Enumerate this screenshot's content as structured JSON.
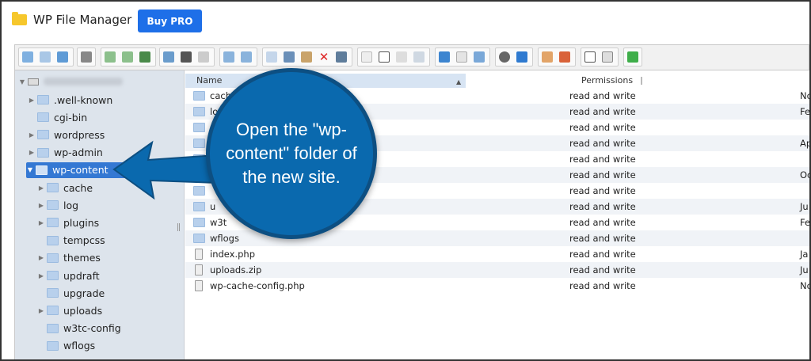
{
  "header": {
    "app_title": "WP File Manager",
    "buy_label": "Buy PRO"
  },
  "tree": {
    "items": [
      {
        "label": ".well-known",
        "indent": 1,
        "arrow": true
      },
      {
        "label": "cgi-bin",
        "indent": 1,
        "arrow": false
      },
      {
        "label": "wordpress",
        "indent": 1,
        "arrow": true
      },
      {
        "label": "wp-admin",
        "indent": 1,
        "arrow": true
      },
      {
        "label": "wp-content",
        "indent": 1,
        "arrow": true,
        "selected": true
      },
      {
        "label": "cache",
        "indent": 2,
        "arrow": true
      },
      {
        "label": "log",
        "indent": 2,
        "arrow": true
      },
      {
        "label": "plugins",
        "indent": 2,
        "arrow": true
      },
      {
        "label": "tempcss",
        "indent": 2,
        "arrow": false
      },
      {
        "label": "themes",
        "indent": 2,
        "arrow": true
      },
      {
        "label": "updraft",
        "indent": 2,
        "arrow": true
      },
      {
        "label": "upgrade",
        "indent": 2,
        "arrow": false
      },
      {
        "label": "uploads",
        "indent": 2,
        "arrow": true
      },
      {
        "label": "w3tc-config",
        "indent": 2,
        "arrow": false
      },
      {
        "label": "wflogs",
        "indent": 2,
        "arrow": false
      }
    ]
  },
  "list": {
    "col_name": "Name",
    "col_permissions": "Permissions",
    "rows": [
      {
        "name": "cache",
        "type": "folder",
        "perm": "read and write",
        "date": "No"
      },
      {
        "name": "lo",
        "type": "folder",
        "perm": "read and write",
        "date": "Fe"
      },
      {
        "name": "",
        "type": "folder",
        "perm": "read and write",
        "date": ""
      },
      {
        "name": "",
        "type": "folder",
        "perm": "read and write",
        "date": "Ap"
      },
      {
        "name": "",
        "type": "folder",
        "perm": "read and write",
        "date": ""
      },
      {
        "name": "",
        "type": "folder",
        "perm": "read and write",
        "date": "Oc"
      },
      {
        "name": "",
        "type": "folder",
        "perm": "read and write",
        "date": ""
      },
      {
        "name": "u",
        "type": "folder",
        "perm": "read and write",
        "date": "Ju"
      },
      {
        "name": "w3t",
        "type": "folder",
        "perm": "read and write",
        "date": "Fe"
      },
      {
        "name": "wflogs",
        "type": "folder",
        "perm": "read and write",
        "date": ""
      },
      {
        "name": "index.php",
        "type": "php",
        "perm": "read and write",
        "date": "Ja"
      },
      {
        "name": "uploads.zip",
        "type": "zip",
        "perm": "read and write",
        "date": "Ju"
      },
      {
        "name": "wp-cache-config.php",
        "type": "php",
        "perm": "read and write",
        "date": "No"
      }
    ]
  },
  "callout": {
    "text": "Open the \"wp-content\" folder of the new site."
  },
  "colors": {
    "accent": "#1e6fe8",
    "callout": "#0a69ae",
    "selection": "#3478d3",
    "tree_bg": "#dde4ec"
  }
}
